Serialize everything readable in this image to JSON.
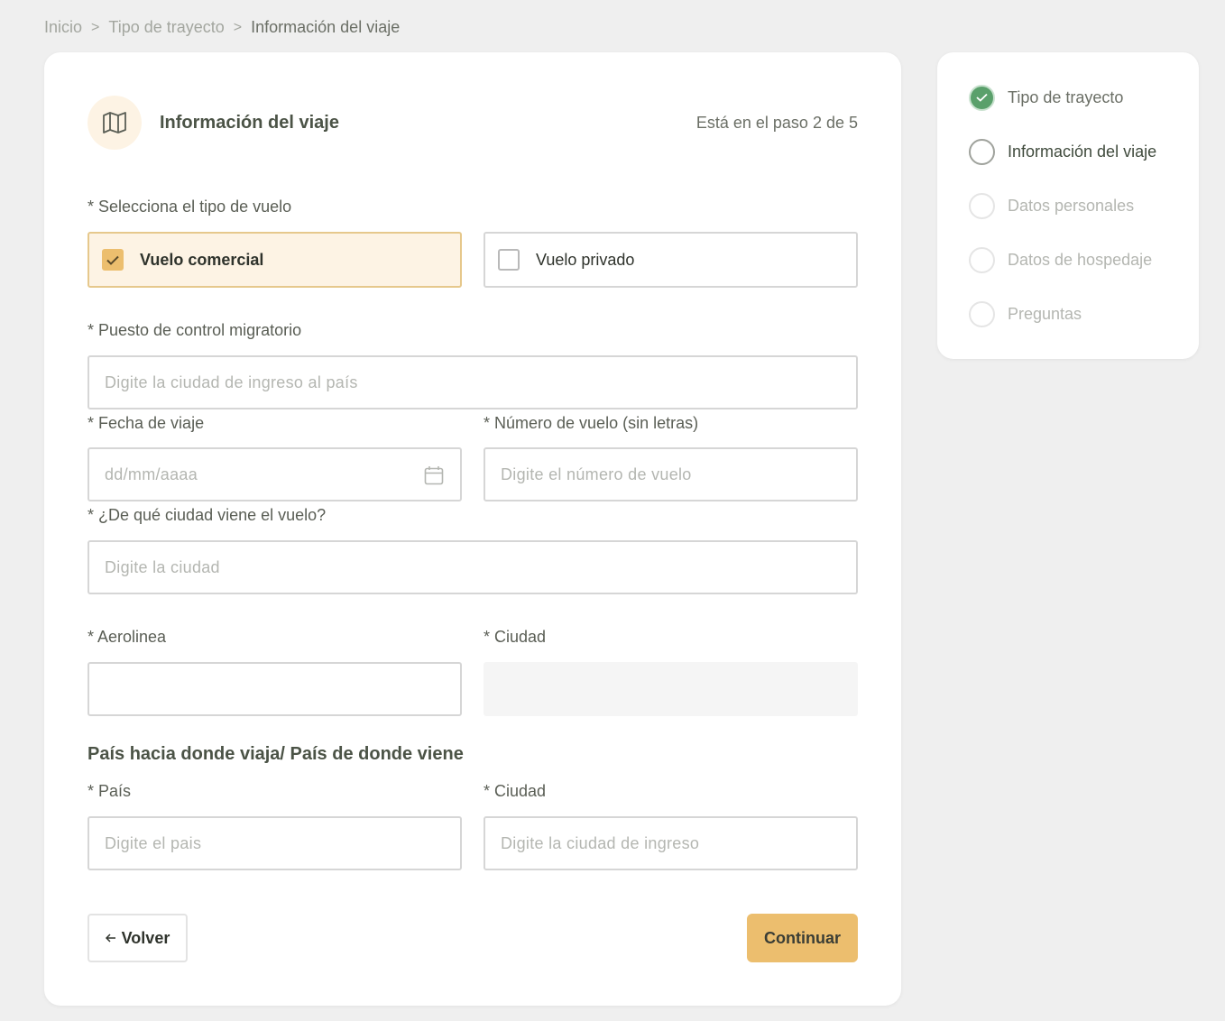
{
  "breadcrumb": {
    "items": [
      "Inicio",
      "Tipo de trayecto",
      "Información del viaje"
    ],
    "separator": ">"
  },
  "header": {
    "icon": "map-icon",
    "title": "Información del viaje",
    "step_text": "Está en el paso 2 de 5"
  },
  "form": {
    "flight_type": {
      "label": "* Selecciona el tipo de vuelo",
      "options": [
        {
          "label": "Vuelo comercial",
          "checked": true
        },
        {
          "label": "Vuelo privado",
          "checked": false
        }
      ]
    },
    "migration_post": {
      "label": "* Puesto de control migratorio",
      "placeholder": "Digite la ciudad de ingreso al país"
    },
    "travel_date": {
      "label": "* Fecha de viaje",
      "placeholder": "dd/mm/aaaa",
      "icon": "calendar-icon"
    },
    "flight_number": {
      "label": "* Número de vuelo (sin letras)",
      "placeholder": "Digite el número de vuelo"
    },
    "origin_city": {
      "label": "* ¿De qué ciudad viene el vuelo?",
      "placeholder": "Digite la ciudad"
    },
    "airline": {
      "label": "* Aerolinea",
      "value": ""
    },
    "airline_city": {
      "label": "* Ciudad",
      "value": ""
    },
    "country_section_title": "País hacia donde viaja/ País de donde viene",
    "country": {
      "label": "* País",
      "placeholder": "Digite el pais"
    },
    "country_city": {
      "label": "* Ciudad",
      "placeholder": "Digite la ciudad de ingreso"
    }
  },
  "actions": {
    "back_label": "Volver",
    "back_icon": "arrow-left-icon",
    "continue_label": "Continuar"
  },
  "steps": [
    {
      "label": "Tipo de trayecto",
      "status": "done"
    },
    {
      "label": "Información del viaje",
      "status": "active"
    },
    {
      "label": "Datos personales",
      "status": "pending"
    },
    {
      "label": "Datos de hospedaje",
      "status": "pending"
    },
    {
      "label": "Preguntas",
      "status": "pending"
    }
  ],
  "colors": {
    "accent": "#ecbe6e",
    "accent_light": "#fdf3e4",
    "success": "#5aa06b",
    "background": "#efefef"
  }
}
